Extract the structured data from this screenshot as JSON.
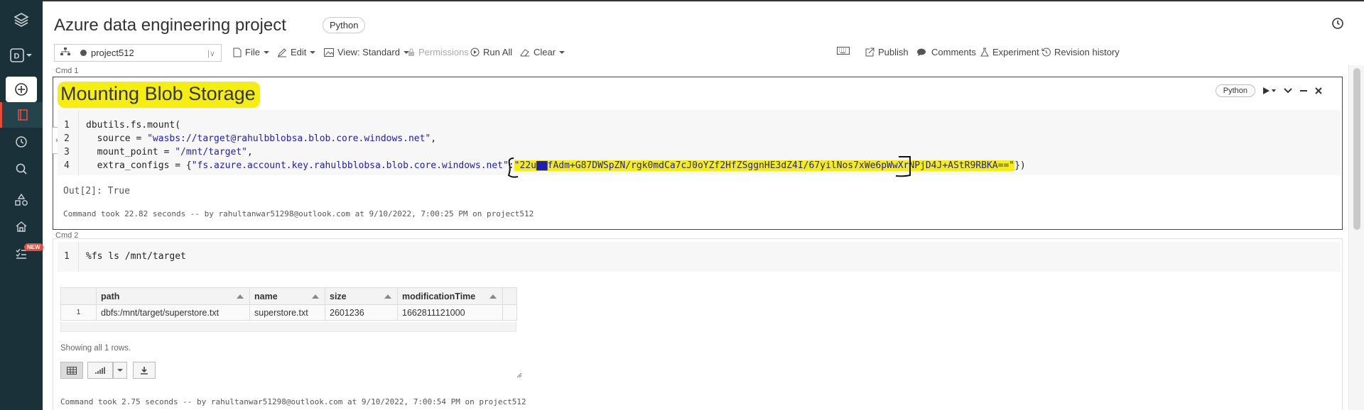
{
  "notebook": {
    "title": "Azure data engineering project",
    "language": "Python"
  },
  "toolbar": {
    "cluster": "project512",
    "file": "File",
    "edit": "Edit",
    "view": "View: Standard",
    "permissions": "Permissions",
    "run_all": "Run All",
    "clear": "Clear",
    "publish": "Publish",
    "comments": "Comments",
    "experiment": "Experiment",
    "revision_history": "Revision history"
  },
  "nav": {
    "new_badge": "NEW"
  },
  "cells": [
    {
      "cmd_label": "Cmd 1",
      "language": "Python",
      "markdown_title": "Mounting Blob Storage",
      "code_lines": [
        {
          "num": "1",
          "pre": "dbutils.fs.mount(",
          "str": "",
          "post": ""
        },
        {
          "num": "2",
          "pre": "  source = ",
          "str": "\"wasbs://target@rahulbblobsa.blob.core.windows.net\"",
          "post": ","
        },
        {
          "num": "3",
          "pre": "  mount_point = ",
          "str": "\"/mnt/target\"",
          "post": ","
        },
        {
          "num": "4",
          "pre": "  extra_configs = {",
          "str": "\"fs.azure.account.key.rahulbblobsa.blob.core.windows.net\"",
          "post": ":",
          "secret": "\"22u▇▇fAdm+G87DWSpZN/rgk0mdCa7cJ0oYZf2HfZSggnHE3dZ4I/67yilNos7xWe6pWwXrNPjD4J+AStR9RBKA==\"",
          "end": "})"
        }
      ],
      "output": "Out[2]: True",
      "footer": "Command took 22.82 seconds -- by rahultanwar51298@outlook.com at 9/10/2022, 7:00:25 PM on project512"
    },
    {
      "cmd_label": "Cmd 2",
      "code_lines": [
        {
          "num": "1",
          "pre": "%fs ls /mnt/target"
        }
      ],
      "table": {
        "columns": [
          "path",
          "name",
          "size",
          "modificationTime"
        ],
        "rows": [
          [
            "1",
            "dbfs:/mnt/target/superstore.txt",
            "superstore.txt",
            "2601236",
            "1662811121000"
          ]
        ]
      },
      "rows_info": "Showing all 1 rows.",
      "footer": "Command took 2.75 seconds -- by rahultanwar51298@outlook.com at 9/10/2022, 7:00:54 PM on project512"
    }
  ]
}
